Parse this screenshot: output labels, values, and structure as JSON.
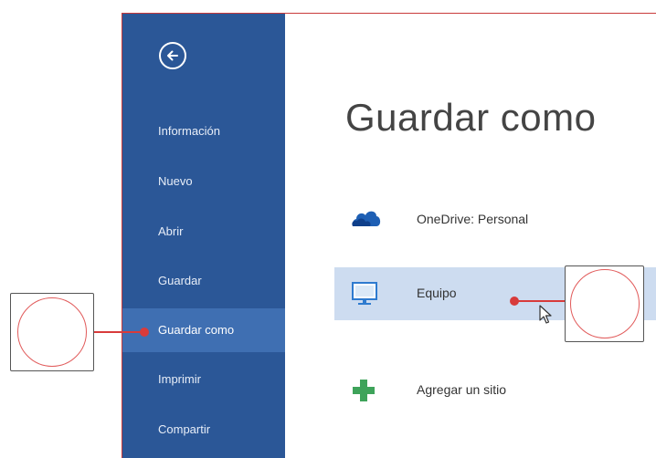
{
  "sidebar": {
    "items": [
      {
        "label": "Información"
      },
      {
        "label": "Nuevo"
      },
      {
        "label": "Abrir"
      },
      {
        "label": "Guardar"
      },
      {
        "label": "Guardar como"
      },
      {
        "label": "Imprimir"
      },
      {
        "label": "Compartir"
      }
    ],
    "selected": "Guardar como"
  },
  "main": {
    "title": "Guardar como",
    "locations": [
      {
        "label": "OneDrive: Personal",
        "icon": "cloud-icon"
      },
      {
        "label": "Equipo",
        "icon": "computer-icon",
        "selected": true
      },
      {
        "label": "Agregar un sitio",
        "icon": "plus-icon"
      }
    ]
  },
  "colors": {
    "sidebar": "#2b5797",
    "sidebar_selected": "#3f6fb2",
    "selected_row": "#cddcf0",
    "callout": "#d83b3b"
  }
}
